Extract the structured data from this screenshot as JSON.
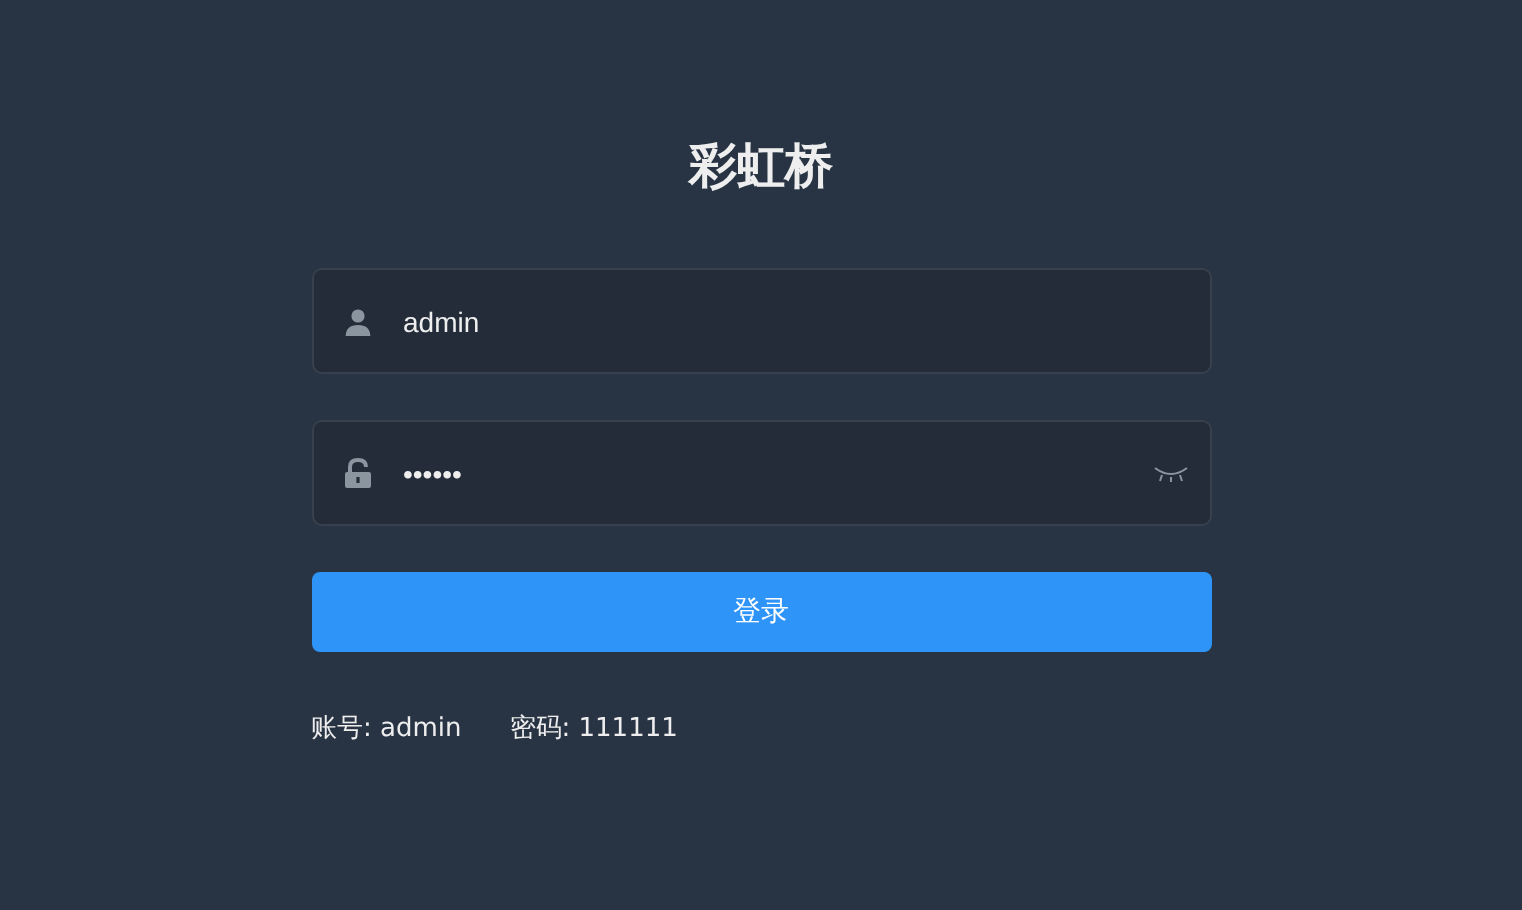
{
  "title": "彩虹桥",
  "fields": [
    {
      "kind": "user",
      "value": "admin"
    },
    {
      "kind": "password",
      "value": "••••••"
    }
  ],
  "login_button": "登录",
  "hints": [
    "账号: admin",
    "密码: 111111"
  ]
}
